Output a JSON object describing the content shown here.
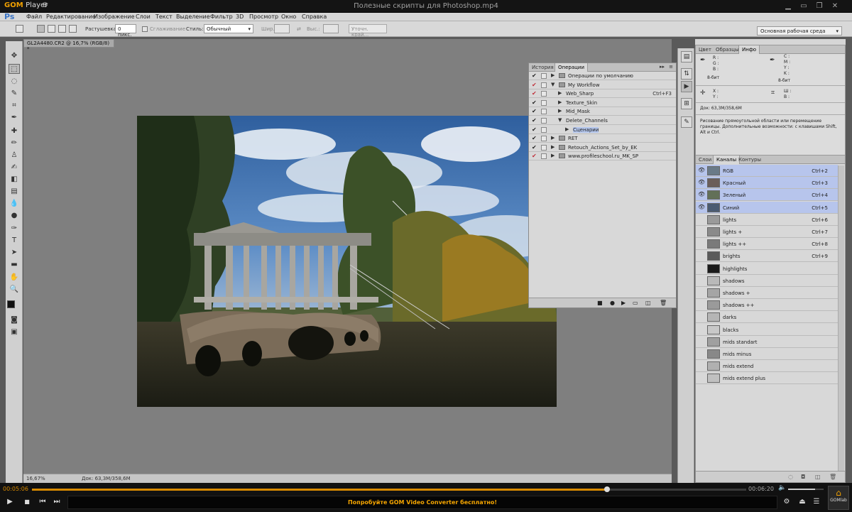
{
  "gom": {
    "logo_gom": "GOM",
    "logo_player": "Player",
    "file_title": "Полезные скрипты для Photoshop.mp4",
    "time_current": "00:05:06",
    "time_total": "00:06:20",
    "progress_fraction": 0.805,
    "volume_fraction": 0.75,
    "promo": "Попробуйте GOM Video Converter бесплатно!",
    "gomlab": "GOMlab",
    "accent": "#f0a000"
  },
  "ps": {
    "logo": "Ps",
    "menu": [
      "Файл",
      "Редактирование",
      "Изображение",
      "Слои",
      "Текст",
      "Выделение",
      "Фильтр",
      "3D",
      "Просмотр",
      "Окно",
      "Справка"
    ],
    "options": {
      "feather_label": "Растушевка:",
      "feather_value": "0 пикс.",
      "antialias_label": "Сглаживание",
      "style_label": "Стиль:",
      "style_value": "Обычный",
      "width_label": "Шир.:",
      "height_label": "Выс.:",
      "refine_button": "Уточн. край...",
      "workspace": "Основная рабочая среда"
    },
    "document": {
      "tab_title": "GL2A4480.CR2 @ 16,7% (RGB/8) *",
      "zoom": "16,67%",
      "doc_size": "Док: 63,3M/358,6M"
    },
    "actions_panel": {
      "tabs": [
        "История",
        "Операции"
      ],
      "rows": [
        {
          "name": "Операции по умолчанию",
          "check": "✔",
          "key": ""
        },
        {
          "name": "My Workflow",
          "check": "✔",
          "key": ""
        },
        {
          "name": "Web_Sharp",
          "check": "✔",
          "key": "Ctrl+F3"
        },
        {
          "name": "Texture_Skin",
          "check": "✔",
          "key": ""
        },
        {
          "name": "Mid_Mask",
          "check": "✔",
          "key": ""
        },
        {
          "name": "Delete_Channels",
          "check": "✔",
          "key": ""
        },
        {
          "name": "Сценарии",
          "check": "✔",
          "key": ""
        },
        {
          "name": "RET",
          "check": "✔",
          "key": ""
        },
        {
          "name": "Retouch_Actions_Set_by_EK",
          "check": "✔",
          "key": ""
        },
        {
          "name": "www.profileschool.ru_MK_SP",
          "check": "✔",
          "key": ""
        }
      ]
    },
    "info_panel": {
      "tabs": [
        "Цвет",
        "Образцы",
        "Инфо"
      ],
      "rgb_labels": [
        "R :",
        "G :",
        "B :"
      ],
      "cmyk_labels": [
        "C :",
        "M :",
        "Y :",
        "K :"
      ],
      "bit_left": "8-бит",
      "bit_right": "8-бит",
      "xy": [
        "X :",
        "Y :"
      ],
      "wh": [
        "Ш :",
        "В :"
      ],
      "doc": "Док: 63,3M/358,6M",
      "hint": "Рисование прямоугольной области или перемещение границы. Дополнительные возможности: с клавишами Shift, Alt и Ctrl."
    },
    "channels_panel": {
      "tabs": [
        "Слои",
        "Каналы",
        "Контуры"
      ],
      "rows": [
        {
          "name": "RGB",
          "key": "Ctrl+2"
        },
        {
          "name": "Красный",
          "key": "Ctrl+3"
        },
        {
          "name": "Зеленый",
          "key": "Ctrl+4"
        },
        {
          "name": "Синий",
          "key": "Ctrl+5"
        },
        {
          "name": "lights",
          "key": "Ctrl+6"
        },
        {
          "name": "lights +",
          "key": "Ctrl+7"
        },
        {
          "name": "lights ++",
          "key": "Ctrl+8"
        },
        {
          "name": "brights",
          "key": "Ctrl+9"
        },
        {
          "name": "highlights",
          "key": ""
        },
        {
          "name": "shadows",
          "key": ""
        },
        {
          "name": "shadows +",
          "key": ""
        },
        {
          "name": "shadows ++",
          "key": ""
        },
        {
          "name": "darks",
          "key": ""
        },
        {
          "name": "blacks",
          "key": ""
        },
        {
          "name": "mids standart",
          "key": ""
        },
        {
          "name": "mids minus",
          "key": ""
        },
        {
          "name": "mids extend",
          "key": ""
        },
        {
          "name": "mids extend plus",
          "key": ""
        }
      ]
    }
  }
}
